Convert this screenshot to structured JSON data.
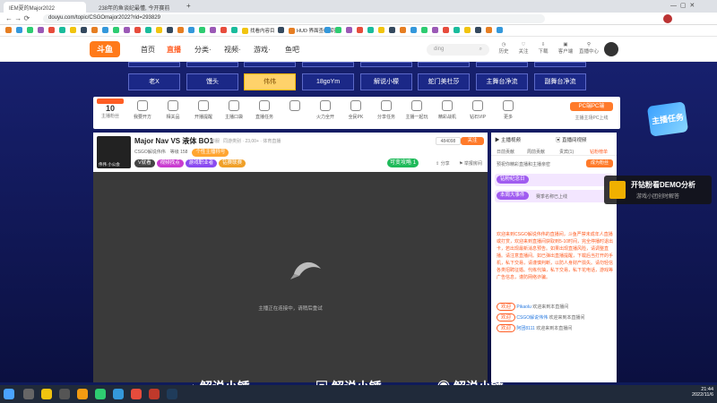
{
  "browser": {
    "tabs": [
      "IEM夏的Major2022",
      "238年的鱼谈纪最懂, 今开赛前",
      "+"
    ],
    "url": "douyu.com/topic/CSGOmajor2022?rid=293829",
    "bookmarks": [
      "",
      "",
      "",
      "",
      "",
      "",
      "",
      "",
      "",
      "",
      "",
      "",
      "",
      "",
      "",
      "",
      "",
      "",
      "",
      "",
      "",
      "",
      "找看内容目",
      "",
      "HUD 界面查纪解密",
      "",
      "",
      "",
      "",
      "",
      "",
      "",
      "",
      "",
      "",
      "",
      "",
      "",
      "",
      "",
      "",
      ""
    ]
  },
  "header": {
    "logo": "斗鱼",
    "nav": [
      "首页",
      "直播",
      "分类·",
      "视频·",
      "游戏·",
      "鱼吧"
    ],
    "search_placeholder": "ding",
    "right_labels": [
      "历史",
      "关注",
      "下载",
      "客户端",
      "直播中心"
    ]
  },
  "categories": {
    "row1": [
      "老X",
      "馒头",
      "伟伟",
      "18goYm",
      "解说小檬",
      "蛇门美杜莎",
      "主舞台净流",
      "副舞台净流"
    ],
    "selected_index": 2
  },
  "actions": {
    "count_value": "10",
    "count_label": "主播粉丝",
    "items": [
      "我要开方",
      "相关品",
      "开播提醒",
      "主播口袋",
      "直播任务",
      "",
      "火力全开",
      "全民PK",
      "分享任务",
      "主播一起玩",
      "精彩战机",
      "钻石VIP",
      "更多"
    ],
    "pk_label": "PC端PC端",
    "pk_sub": "主播主场PC上线"
  },
  "room": {
    "title": "Major Nav VS 液体 BO1",
    "category": "单服",
    "meta": "同游类别 · 23,00+ · 体育直播",
    "tag1": "CSGO解说伟伟",
    "tag2": "等级 158",
    "tag3": "个性主播称号",
    "badges": [
      "V就看",
      "视频找点",
      "游戏职业者",
      "钻赛联赛"
    ],
    "anchor_name": "伟伟 小公会",
    "follow_count": "484098",
    "follow_label": "关注",
    "battle_label": "可变攻略",
    "battle_count": "1",
    "share": "分享",
    "report": "举报房间"
  },
  "player": {
    "status": "主播正在连接中，请稍后重试"
  },
  "sidebar": {
    "tabs_top": [
      "主播视频",
      "直播间视频"
    ],
    "tabs": [
      "日前贡献",
      "周前贡献",
      "贵宾(1)",
      "钻粉榜单"
    ],
    "promo": "预祝你精彩直播和主播亲密",
    "promo_button": "成为粉丝",
    "notice1_tag": "钻粉纪念日",
    "notice2_tag": "本周大事件",
    "notice_text": "赛季名称已上线",
    "msg_greet": "欢迎来到CSGO解说伟伟的直播间，斗鱼严禁未成年人直播或打赏，欢迎来到直播间获取到5-10时间，完全停播时退出卡，若出现最新消息预告。如果出现直播风险，请调整直播。请注意直播间。如已弹出直播提醒，下载后当打开的手机，私下交易，请谨慎判断，以防人身财产损失。请勿轻信各类招聘征婚。代练代抽，私下交易，私下花电话，游戏等广告信息，谨防网络诈骗。",
    "msg_rows": [
      {
        "user": "Pikaolu",
        "text": "欢迎来到本直播间"
      },
      {
        "user": "CSGO解说伟伟",
        "text": "欢迎来到本直播间"
      },
      {
        "user": "阿团8111",
        "text": "欢迎来到本直播间"
      }
    ],
    "input_placeholder": ""
  },
  "overlay": {
    "demo_title": "开钻粉看DEMO分析",
    "demo_sub": "游戏小团创时解答",
    "float_badge": "主播任务"
  },
  "watermark": {
    "items": [
      "解说小锤",
      "解说小锤",
      "解说小锤"
    ]
  },
  "taskbar": {
    "time": "21:44",
    "date": "2022/11/6"
  },
  "colors": {
    "accent": "#ff5d23",
    "page_bg": "#17206e"
  }
}
